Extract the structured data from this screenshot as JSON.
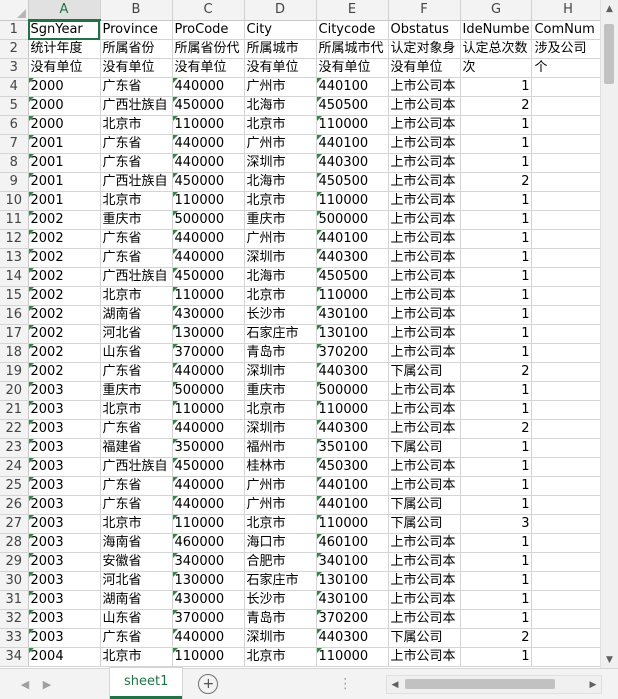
{
  "columns": [
    "A",
    "B",
    "C",
    "D",
    "E",
    "F",
    "G",
    "H"
  ],
  "selected_column": "A",
  "rows": [
    {
      "n": "1",
      "cells": [
        "SgnYear",
        "Province",
        "ProCode",
        "City",
        "Citycode",
        "Obstatus",
        "IdeNumbe",
        "ComNum"
      ]
    },
    {
      "n": "2",
      "cells": [
        "统计年度",
        "所属省份",
        "所属省份代",
        "所属城市",
        "所属城市代",
        "认定对象身",
        "认定总次数",
        "涉及公司"
      ]
    },
    {
      "n": "3",
      "cells": [
        "没有单位",
        "没有单位",
        "没有单位",
        "没有单位",
        "没有单位",
        "没有单位",
        "次",
        "个"
      ]
    },
    {
      "n": "4",
      "cells": [
        "2000",
        "广东省",
        "440000",
        "广州市",
        "440100",
        "上市公司本",
        "1",
        ""
      ]
    },
    {
      "n": "5",
      "cells": [
        "2000",
        "广西壮族自",
        "450000",
        "北海市",
        "450500",
        "上市公司本",
        "2",
        ""
      ]
    },
    {
      "n": "6",
      "cells": [
        "2000",
        "北京市",
        "110000",
        "北京市",
        "110000",
        "上市公司本",
        "1",
        ""
      ]
    },
    {
      "n": "7",
      "cells": [
        "2001",
        "广东省",
        "440000",
        "广州市",
        "440100",
        "上市公司本",
        "1",
        ""
      ]
    },
    {
      "n": "8",
      "cells": [
        "2001",
        "广东省",
        "440000",
        "深圳市",
        "440300",
        "上市公司本",
        "1",
        ""
      ]
    },
    {
      "n": "9",
      "cells": [
        "2001",
        "广西壮族自",
        "450000",
        "北海市",
        "450500",
        "上市公司本",
        "2",
        ""
      ]
    },
    {
      "n": "10",
      "cells": [
        "2001",
        "北京市",
        "110000",
        "北京市",
        "110000",
        "上市公司本",
        "1",
        ""
      ]
    },
    {
      "n": "11",
      "cells": [
        "2002",
        "重庆市",
        "500000",
        "重庆市",
        "500000",
        "上市公司本",
        "1",
        ""
      ]
    },
    {
      "n": "12",
      "cells": [
        "2002",
        "广东省",
        "440000",
        "广州市",
        "440100",
        "上市公司本",
        "1",
        ""
      ]
    },
    {
      "n": "13",
      "cells": [
        "2002",
        "广东省",
        "440000",
        "深圳市",
        "440300",
        "上市公司本",
        "1",
        ""
      ]
    },
    {
      "n": "14",
      "cells": [
        "2002",
        "广西壮族自",
        "450000",
        "北海市",
        "450500",
        "上市公司本",
        "1",
        ""
      ]
    },
    {
      "n": "15",
      "cells": [
        "2002",
        "北京市",
        "110000",
        "北京市",
        "110000",
        "上市公司本",
        "1",
        ""
      ]
    },
    {
      "n": "16",
      "cells": [
        "2002",
        "湖南省",
        "430000",
        "长沙市",
        "430100",
        "上市公司本",
        "1",
        ""
      ]
    },
    {
      "n": "17",
      "cells": [
        "2002",
        "河北省",
        "130000",
        "石家庄市",
        "130100",
        "上市公司本",
        "1",
        ""
      ]
    },
    {
      "n": "18",
      "cells": [
        "2002",
        "山东省",
        "370000",
        "青岛市",
        "370200",
        "上市公司本",
        "1",
        ""
      ]
    },
    {
      "n": "19",
      "cells": [
        "2002",
        "广东省",
        "440000",
        "深圳市",
        "440300",
        "下属公司",
        "2",
        ""
      ]
    },
    {
      "n": "20",
      "cells": [
        "2003",
        "重庆市",
        "500000",
        "重庆市",
        "500000",
        "上市公司本",
        "1",
        ""
      ]
    },
    {
      "n": "21",
      "cells": [
        "2003",
        "北京市",
        "110000",
        "北京市",
        "110000",
        "上市公司本",
        "1",
        ""
      ]
    },
    {
      "n": "22",
      "cells": [
        "2003",
        "广东省",
        "440000",
        "深圳市",
        "440300",
        "上市公司本",
        "2",
        ""
      ]
    },
    {
      "n": "23",
      "cells": [
        "2003",
        "福建省",
        "350000",
        "福州市",
        "350100",
        "下属公司",
        "1",
        ""
      ]
    },
    {
      "n": "24",
      "cells": [
        "2003",
        "广西壮族自",
        "450000",
        "桂林市",
        "450300",
        "上市公司本",
        "1",
        ""
      ]
    },
    {
      "n": "25",
      "cells": [
        "2003",
        "广东省",
        "440000",
        "广州市",
        "440100",
        "上市公司本",
        "1",
        ""
      ]
    },
    {
      "n": "26",
      "cells": [
        "2003",
        "广东省",
        "440000",
        "广州市",
        "440100",
        "下属公司",
        "1",
        ""
      ]
    },
    {
      "n": "27",
      "cells": [
        "2003",
        "北京市",
        "110000",
        "北京市",
        "110000",
        "下属公司",
        "3",
        ""
      ]
    },
    {
      "n": "28",
      "cells": [
        "2003",
        "海南省",
        "460000",
        "海口市",
        "460100",
        "上市公司本",
        "1",
        ""
      ]
    },
    {
      "n": "29",
      "cells": [
        "2003",
        "安徽省",
        "340000",
        "合肥市",
        "340100",
        "上市公司本",
        "1",
        ""
      ]
    },
    {
      "n": "30",
      "cells": [
        "2003",
        "河北省",
        "130000",
        "石家庄市",
        "130100",
        "上市公司本",
        "1",
        ""
      ]
    },
    {
      "n": "31",
      "cells": [
        "2003",
        "湖南省",
        "430000",
        "长沙市",
        "430100",
        "上市公司本",
        "1",
        ""
      ]
    },
    {
      "n": "32",
      "cells": [
        "2003",
        "山东省",
        "370000",
        "青岛市",
        "370200",
        "上市公司本",
        "1",
        ""
      ]
    },
    {
      "n": "33",
      "cells": [
        "2003",
        "广东省",
        "440000",
        "深圳市",
        "440300",
        "下属公司",
        "2",
        ""
      ]
    },
    {
      "n": "34",
      "cells": [
        "2004",
        "北京市",
        "110000",
        "北京市",
        "110000",
        "上市公司本",
        "1",
        ""
      ]
    }
  ],
  "sheet_tab": "sheet1",
  "add_sheet_symbol": "+",
  "colors": {
    "accent": "#217346",
    "grid": "#d4d4d4",
    "header_bg": "#f3f3f3"
  }
}
